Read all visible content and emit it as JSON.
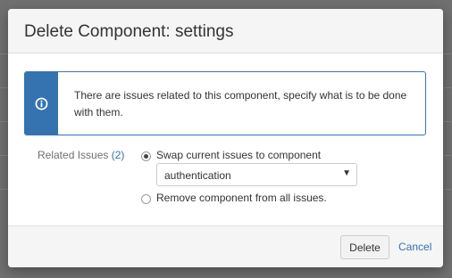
{
  "dialog": {
    "title": "Delete Component: settings"
  },
  "message": {
    "icon": "info-icon",
    "text": "There are issues related to this component, specify what is to be done with them."
  },
  "form": {
    "field_label": "Related Issues",
    "issue_count": "(2)",
    "options": [
      {
        "label": "Swap current issues to component",
        "selected": true
      },
      {
        "label": "Remove component from all issues.",
        "selected": false
      }
    ],
    "component_select": {
      "value": "authentication"
    }
  },
  "footer": {
    "delete_label": "Delete",
    "cancel_label": "Cancel"
  },
  "colors": {
    "accent": "#3572b0",
    "overlay": "#707070"
  }
}
